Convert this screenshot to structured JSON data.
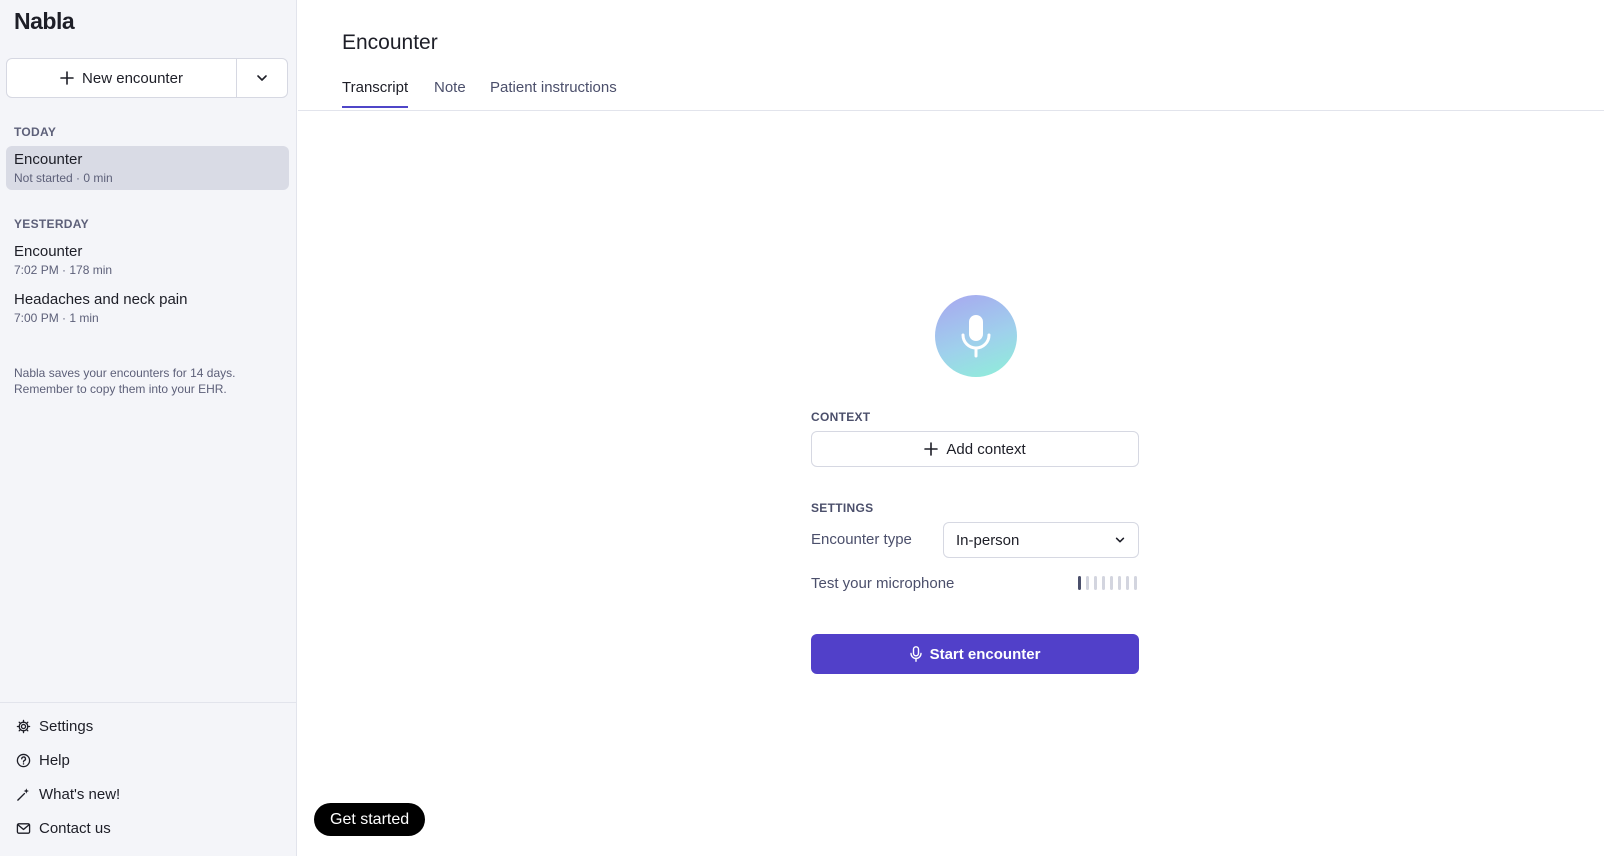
{
  "app": {
    "logo": "Nabla"
  },
  "sidebar": {
    "new_encounter_label": "New encounter",
    "sections": [
      {
        "label": "TODAY",
        "items": [
          {
            "title": "Encounter",
            "subtitle": "Not started · 0 min",
            "active": true
          }
        ]
      },
      {
        "label": "YESTERDAY",
        "items": [
          {
            "title": "Encounter",
            "subtitle": "7:02 PM · 178 min",
            "active": false
          },
          {
            "title": "Headaches and neck pain",
            "subtitle": "7:00 PM · 1 min",
            "active": false
          }
        ]
      }
    ],
    "note": "Nabla saves your encounters for 14 days. Remember to copy them into your EHR.",
    "footer": [
      {
        "label": "Settings",
        "icon": "gear-icon"
      },
      {
        "label": "Help",
        "icon": "help-circle-icon"
      },
      {
        "label": "What's new!",
        "icon": "sparkle-icon"
      },
      {
        "label": "Contact us",
        "icon": "mail-icon"
      }
    ]
  },
  "main": {
    "title": "Encounter",
    "tabs": [
      {
        "label": "Transcript",
        "active": true
      },
      {
        "label": "Note",
        "active": false
      },
      {
        "label": "Patient instructions",
        "active": false
      }
    ],
    "context_label": "CONTEXT",
    "add_context_label": "Add context",
    "settings_label": "SETTINGS",
    "encounter_type_label": "Encounter type",
    "encounter_type_value": "In-person",
    "test_microphone_label": "Test your microphone",
    "mic_level": 0.125,
    "start_label": "Start encounter",
    "get_started_label": "Get started"
  },
  "colors": {
    "accent": "#5140c9",
    "sidebar_bg": "#f4f5f9",
    "active_item_bg": "#d9dbe5"
  }
}
